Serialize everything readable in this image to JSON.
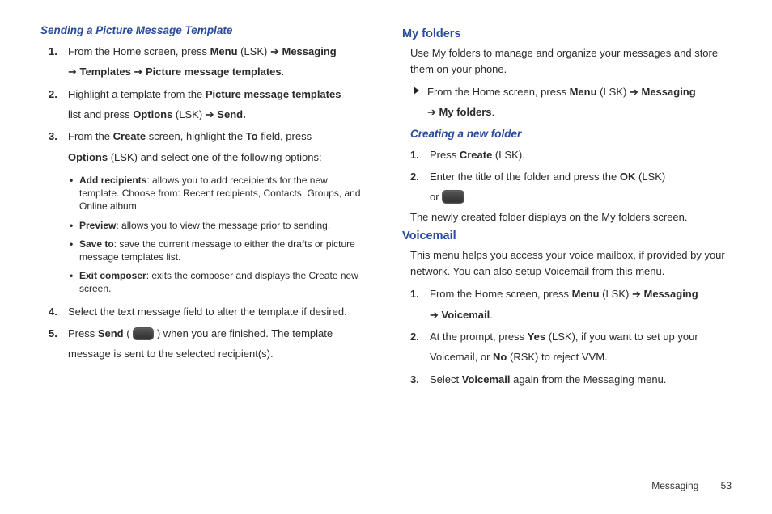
{
  "left": {
    "heading": "Sending a Picture Message Template",
    "steps": [
      {
        "pre": "From the Home screen, press ",
        "b1": "Menu",
        "mid1": " (LSK) ",
        "arr1": "➔",
        "b2": " Messaging",
        "br": true,
        "arr2": "➔",
        "b3": " Templates ",
        "arr3": "➔",
        "b4": " Picture message templates",
        "post": "."
      },
      {
        "pre": "Highlight a template from the ",
        "b1": "Picture message templates",
        "br": true,
        "mid1": "list and press ",
        "b2": "Options",
        "mid2": " (LSK) ",
        "arr1": "➔",
        "b3": " Send."
      },
      {
        "pre": "From the ",
        "b1": "Create",
        "mid1": " screen, highlight the ",
        "b2": "To",
        "mid2": " field, press",
        "br": true,
        "b3": "Options",
        "post": " (LSK) and select one of the following options:"
      },
      {
        "pre": "Select the text message field to alter the template if desired."
      },
      {
        "pre": "Press ",
        "b1": "Send",
        "mid1": " ( ",
        "icon": true,
        "mid2": " ) when you are finished. The template message is sent to the selected recipient(s)."
      }
    ],
    "bullets": [
      {
        "b": "Add recipients",
        "t": ": allows you to add receipients for the new template. Choose from: Recent recipients, Contacts, Groups, and Online album."
      },
      {
        "b": "Preview",
        "t": ": allows you to view the message prior to sending."
      },
      {
        "b": "Save to",
        "t": ": save the current message to either the drafts or picture message templates list."
      },
      {
        "b": "Exit composer",
        "t": ": exits the composer and displays the Create new screen."
      }
    ]
  },
  "right": {
    "myfolders": {
      "title": "My folders",
      "intro": "Use My folders to manage and organize your messages and store them on your phone.",
      "arrow": {
        "pre": "From the Home screen, press ",
        "b1": "Menu",
        "mid1": " (LSK) ",
        "arr1": "➔",
        "b2": " Messaging",
        "br": true,
        "arr2": "➔",
        "b3": " My folders",
        "post": "."
      },
      "sub": "Creating a new folder",
      "steps": [
        {
          "pre": "Press ",
          "b1": "Create",
          "post": " (LSK)."
        },
        {
          "pre": "Enter the title of the folder and press the ",
          "b1": "OK",
          "mid1": " (LSK)",
          "br": true,
          "mid2": "or  ",
          "icon": true,
          "post": " ."
        }
      ],
      "outro": "The newly created folder displays on the My folders screen."
    },
    "voicemail": {
      "title": "Voicemail",
      "intro": "This menu helps you access your voice mailbox, if provided by your network. You can also setup Voicemail from this menu.",
      "steps": [
        {
          "pre": "From the Home screen, press ",
          "b1": "Menu",
          "mid1": " (LSK) ",
          "arr1": "➔",
          "b2": " Messaging",
          "br": true,
          "arr2": "➔",
          "b3": " Voicemail",
          "post": "."
        },
        {
          "pre": "At the prompt, press ",
          "b1": "Yes",
          "mid1": " (LSK), if you want to set up your Voicemail, or ",
          "b2": "No",
          "post": " (RSK) to reject VVM."
        },
        {
          "pre": "Select ",
          "b1": "Voicemail",
          "post": " again from the Messaging menu."
        }
      ]
    }
  },
  "footer": {
    "section": "Messaging",
    "page": "53"
  }
}
